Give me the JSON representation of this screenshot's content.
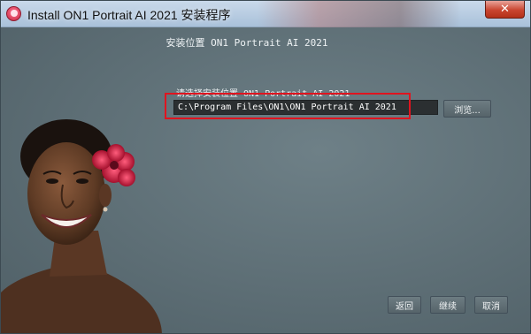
{
  "window": {
    "title": "Install ON1 Portrait AI 2021 安装程序",
    "close_icon": "close-icon",
    "app_icon": "on1-app-icon"
  },
  "installer": {
    "heading": "安装位置 ON1 Portrait AI 2021",
    "prompt": "请选择安装位置 ON1 Portrait AI 2021",
    "install_path": "C:\\Program Files\\ON1\\ON1 Portrait AI 2021",
    "browse_label": "浏览...",
    "back_label": "返回",
    "next_label": "继续",
    "cancel_label": "取消"
  },
  "colors": {
    "background": "#5d6e75",
    "highlight": "#e0141f",
    "flower": "#c8183c"
  }
}
